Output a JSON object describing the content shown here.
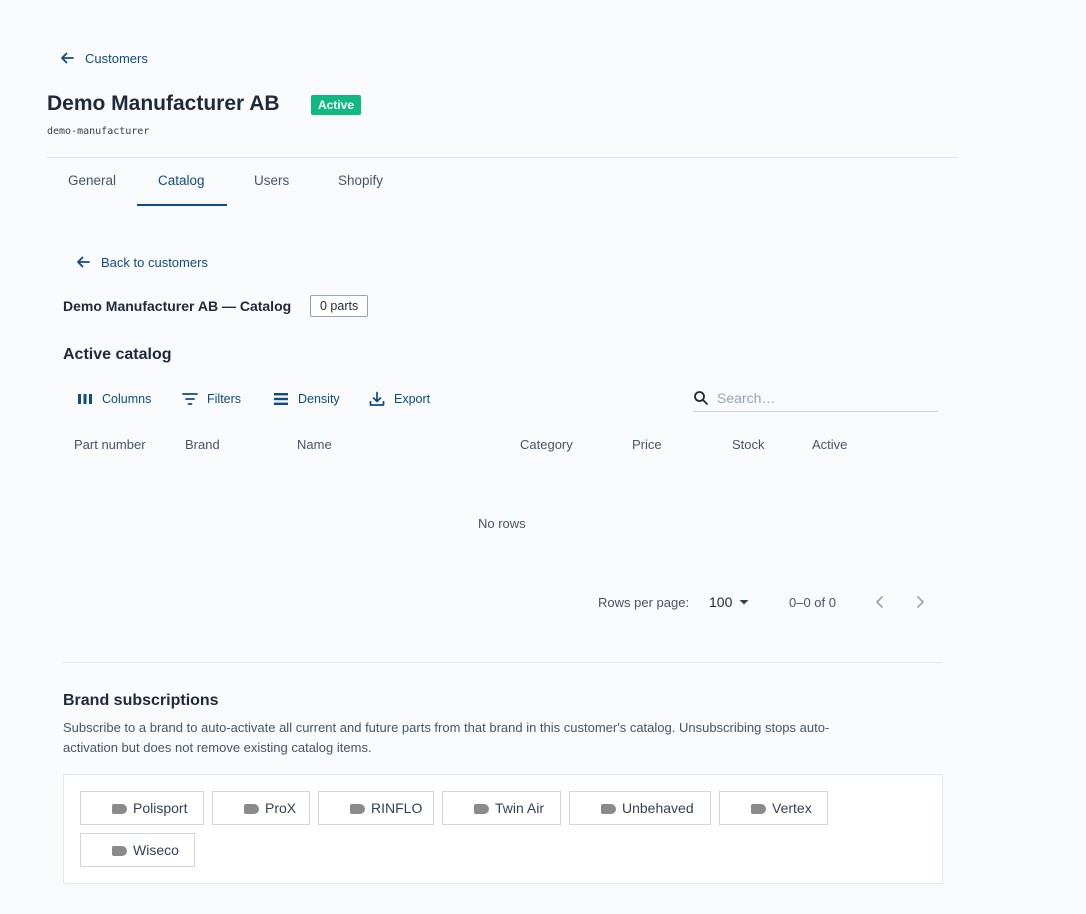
{
  "header": {
    "back_label": "Customers",
    "title": "Demo Manufacturer AB",
    "status": "Active",
    "slug": "demo-manufacturer"
  },
  "tabs": [
    {
      "label": "General"
    },
    {
      "label": "Catalog",
      "active": true
    },
    {
      "label": "Users"
    },
    {
      "label": "Shopify"
    }
  ],
  "catalog": {
    "back_label": "Back to customers",
    "subtitle": "Demo Manufacturer AB — Catalog",
    "parts_count": "0 parts",
    "section_title": "Active catalog",
    "toolbar": {
      "columns": "Columns",
      "filters": "Filters",
      "density": "Density",
      "export": "Export",
      "search_placeholder": "Search…"
    },
    "columns": [
      "Part number",
      "Brand",
      "Name",
      "Category",
      "Price",
      "Stock",
      "Active"
    ],
    "empty_text": "No rows",
    "pagination": {
      "rows_per_page_label": "Rows per page:",
      "rows_per_page": "100",
      "range": "0–0 of 0"
    }
  },
  "brands": {
    "title": "Brand subscriptions",
    "description_line1": "Subscribe to a brand to auto-activate all current and future parts from that brand in this customer's catalog. Unsubscribing stops auto-",
    "description_line2": "activation but does not remove existing catalog items.",
    "items": [
      {
        "label": "Polisport",
        "subscribed": false
      },
      {
        "label": "ProX",
        "subscribed": false
      },
      {
        "label": "RINFLO",
        "subscribed": false
      },
      {
        "label": "Twin Air",
        "subscribed": false
      },
      {
        "label": "Unbehaved",
        "subscribed": false
      },
      {
        "label": "Vertex",
        "subscribed": false
      },
      {
        "label": "Wiseco",
        "subscribed": false
      }
    ]
  },
  "colors": {
    "accent": "#0f4c81",
    "status_active": "#10b981",
    "background": "#f8fafc"
  },
  "icons": [
    "arrow-left-icon",
    "columns-icon",
    "filter-icon",
    "density-icon",
    "export-icon",
    "search-icon",
    "caret-down-icon",
    "chevron-left-icon",
    "chevron-right-icon"
  ]
}
